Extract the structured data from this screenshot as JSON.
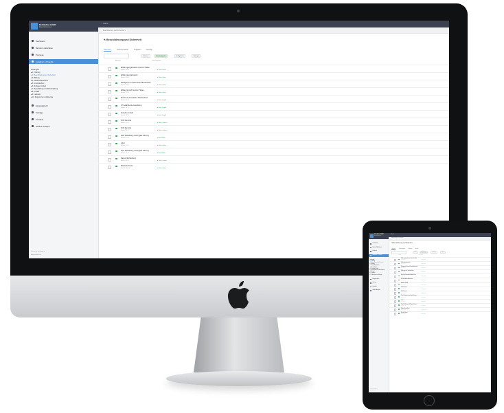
{
  "app": {
    "brand_line1": "Rehdiehre GÜHR",
    "brand_line2": "Bauunternehmen",
    "search_placeholder": "Suche",
    "breadcrumb_tab": "Beschilderung und Sicherheit",
    "page_title": "Beschilderung und Sicherheit",
    "tabs": [
      "Übersicht",
      "Dokumentation",
      "Aufgaben",
      "Verträge"
    ],
    "filters": [
      "Status",
      "Zuständigkeit",
      "Fälligkeit",
      "Rating"
    ],
    "table_headers": [
      "Aktivität",
      "Verantwortlich"
    ],
    "nav": [
      {
        "label": "Dashboard",
        "icon": "dashboard-icon"
      },
      {
        "label": "Betrieb & Aktivitäten",
        "icon": "list-icon"
      },
      {
        "label": "Prozesse",
        "icon": "folder-icon"
      },
      {
        "label": "Aufgaben & Projekte",
        "icon": "folder-icon"
      }
    ],
    "tree_title": "Prüfungen",
    "tree": [
      "1. Führung",
      "2. Beschilderung und Sicherheit",
      "3. Bildung",
      "4. Gesundheitsschutz",
      "5. Umweltschutz",
      "6. Soziales Umfeld",
      "7. Beschaffung und Wertschöpfung",
      "8. Umfeld",
      "9. Lieferant",
      "10. Ressourcen und Energie"
    ],
    "lower_nav": [
      {
        "label": "Eingangsbuch",
        "icon": "inbox-icon"
      },
      {
        "label": "Verträge",
        "icon": "doc-icon"
      },
      {
        "label": "Kontakte",
        "icon": "person-icon"
      },
      {
        "label": "Weitere Anlagen",
        "icon": "folder-icon"
      }
    ],
    "rows": [
      {
        "title": "Erklärungsorganisation Grenzen Halten",
        "sub": "Bericht 02.08",
        "owner": "Martin Voigt"
      },
      {
        "title": "Erklärungsorganisation",
        "sub": "Bericht 09.08",
        "owner": "Martin Voigt"
      },
      {
        "title": "Management Umwelt Gesundheitsschutz",
        "sub": "Bericht 12.09",
        "owner": "Martin Voigt"
      },
      {
        "title": "Erklärung nach Grenzen Halten",
        "sub": "Bericht 17.10",
        "owner": "Martin Voigt"
      },
      {
        "title": "Bericht mit Innovations Arbeitsschutz",
        "sub": "Bericht 05.11",
        "owner": "Anke Jungell"
      },
      {
        "title": "AT Gefahrdende Auswirkung",
        "sub": "Bericht 18.11",
        "owner": "Anke Jungell"
      },
      {
        "title": "Aktuelles Umfeld",
        "sub": "Bericht 23.11",
        "owner": "Anke Jungell"
      },
      {
        "title": "SOS Kontrolle",
        "sub": "Bericht 29.11",
        "owner": "Martin Leitner"
      },
      {
        "title": "SOS Kontrolle",
        "sub": "Bericht 03.12",
        "owner": "Martin Leitner"
      },
      {
        "title": "Ziele & Erklärung und Projekt Führung",
        "sub": "Bericht 07.12",
        "owner": "Anja Müller"
      },
      {
        "title": "Lokal",
        "sub": "Bericht 11.12",
        "owner": "Martin Voigt"
      },
      {
        "title": "Ziele & Erklärung und Projekt Führung",
        "sub": "Bericht 14.12",
        "owner": "Anja Müller"
      },
      {
        "title": "Rapport Entwicklung",
        "sub": "Bericht 18.12",
        "owner": "Martin Leitner"
      },
      {
        "title": "Baustelle Haus 1",
        "sub": "Bericht 20.12",
        "owner": "Martin Voigt"
      }
    ],
    "footer_line1": "Version 4.8.0 Build 2",
    "footer_line2": "Angemeldet als"
  },
  "colors": {
    "topbar": "#3b4150",
    "accent": "#4a90d9",
    "green": "#2ea44f",
    "sidebar": "#f4f5f6",
    "active_nav": "#4a90d9"
  }
}
